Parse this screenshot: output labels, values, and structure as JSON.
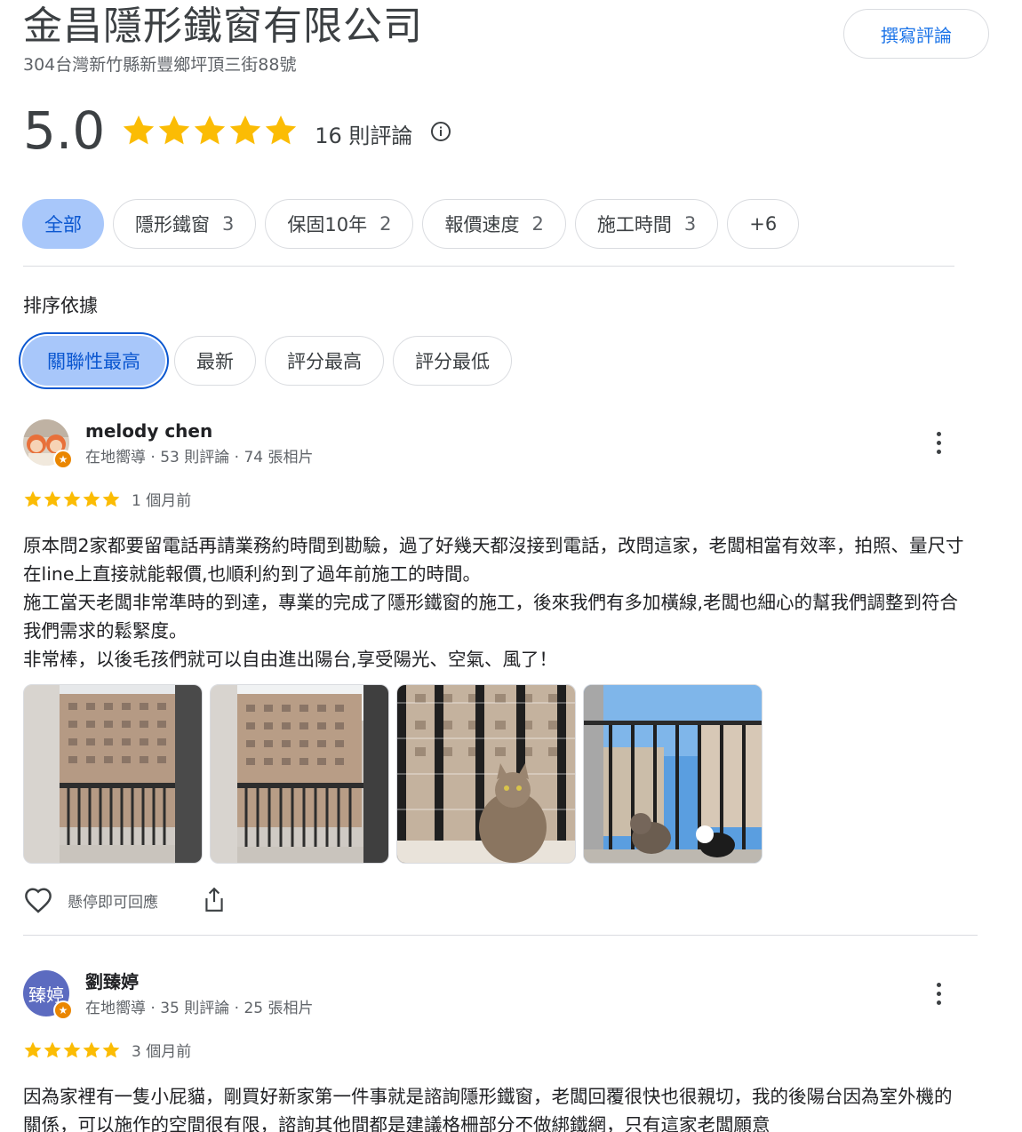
{
  "business": {
    "name": "金昌隱形鐵窗有限公司",
    "address": "304台灣新竹縣新豐鄉坪頂三街88號",
    "write_review_label": "撰寫評論"
  },
  "rating": {
    "value": "5.0",
    "stars": 5,
    "review_count_label": "16 則評論"
  },
  "filter_chips": [
    {
      "label": "全部",
      "count": "",
      "active": true
    },
    {
      "label": "隱形鐵窗",
      "count": "3"
    },
    {
      "label": "保固10年",
      "count": "2"
    },
    {
      "label": "報價速度",
      "count": "2"
    },
    {
      "label": "施工時間",
      "count": "3"
    },
    {
      "label": "+6",
      "count": ""
    }
  ],
  "sort": {
    "label": "排序依據",
    "options": [
      "關聯性最高",
      "最新",
      "評分最高",
      "評分最低"
    ],
    "selected": "關聯性最高"
  },
  "colors": {
    "star": "#fbbc04",
    "accent": "#1a73e8",
    "chip_active_bg": "#a8c7fa",
    "local_guide_badge": "#ea8600"
  },
  "reviews": [
    {
      "name": "melody chen",
      "meta": "在地嚮導 · 53 則評論 · 74 張相片",
      "stars": 5,
      "time": "1 個月前",
      "text": [
        "原本問2家都要留電話再請業務約時間到勘驗，過了好幾天都沒接到電話，改問這家，老闆相當有效率，拍照、量尺寸在line上直接就能報價,也順利約到了過年前施工的時間。",
        "施工當天老闆非常準時的到達，專業的完成了隱形鐵窗的施工，後來我們有多加橫線,老闆也細心的幫我們調整到符合我們需求的鬆緊度。",
        "非常棒，以後毛孩們就可以自由進出陽台,享受陽光、空氣、風了！"
      ],
      "photos": [
        "balcony-photo",
        "balcony-photo",
        "cat-balcony-photo",
        "cats-balcony-photo"
      ],
      "like_label": "懸停即可回應"
    },
    {
      "name": "劉臻婷",
      "avatar_text": "臻婷",
      "meta": "在地嚮導 · 35 則評論 · 25 張相片",
      "stars": 5,
      "time": "3 個月前",
      "text": [
        "因為家裡有一隻小屁貓，剛買好新家第一件事就是諮詢隱形鐵窗，老闆回覆很快也很親切，我的後陽台因為室外機的關係，可以施作的空間很有限，諮詢其他間都是建議格柵部分不做綁鐵網，只有這家老闆願意"
      ]
    }
  ]
}
